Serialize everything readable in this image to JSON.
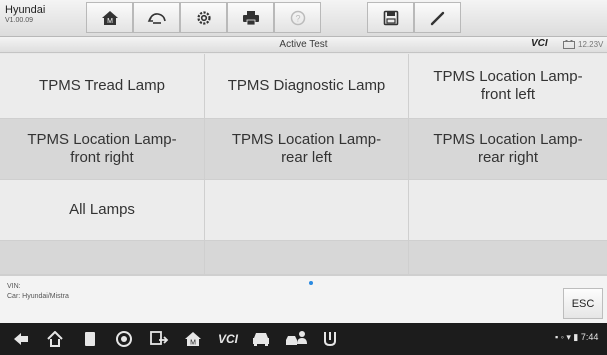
{
  "header": {
    "brand": "Hyundai",
    "version": "V1.00.09",
    "toolbar": [
      {
        "icon": "home-icon"
      },
      {
        "icon": "vehicle-swap-icon"
      },
      {
        "icon": "settings-gear-icon"
      },
      {
        "icon": "print-icon"
      },
      {
        "icon": "help-icon"
      },
      {
        "icon": "save-icon"
      },
      {
        "icon": "pen-icon"
      }
    ]
  },
  "status": {
    "title": "Active Test",
    "vci_label": "VCI",
    "voltage": "12.23V"
  },
  "grid": {
    "items": [
      "TPMS Tread Lamp",
      "TPMS Diagnostic Lamp",
      "TPMS Location Lamp-\nfront left",
      "TPMS Location Lamp-\nfront right",
      "TPMS Location Lamp-\nrear left",
      "TPMS Location Lamp-\nrear right",
      "All Lamps"
    ]
  },
  "footer": {
    "vin_label": "VIN:",
    "car_label": "Car: Hyundai/Mistra",
    "esc_label": "ESC"
  },
  "nav": {
    "status_time": "7:44",
    "vcl_label": "VCI"
  },
  "colors": {
    "accent": "#2a8ae0",
    "navbar": "#1c1c1c"
  }
}
